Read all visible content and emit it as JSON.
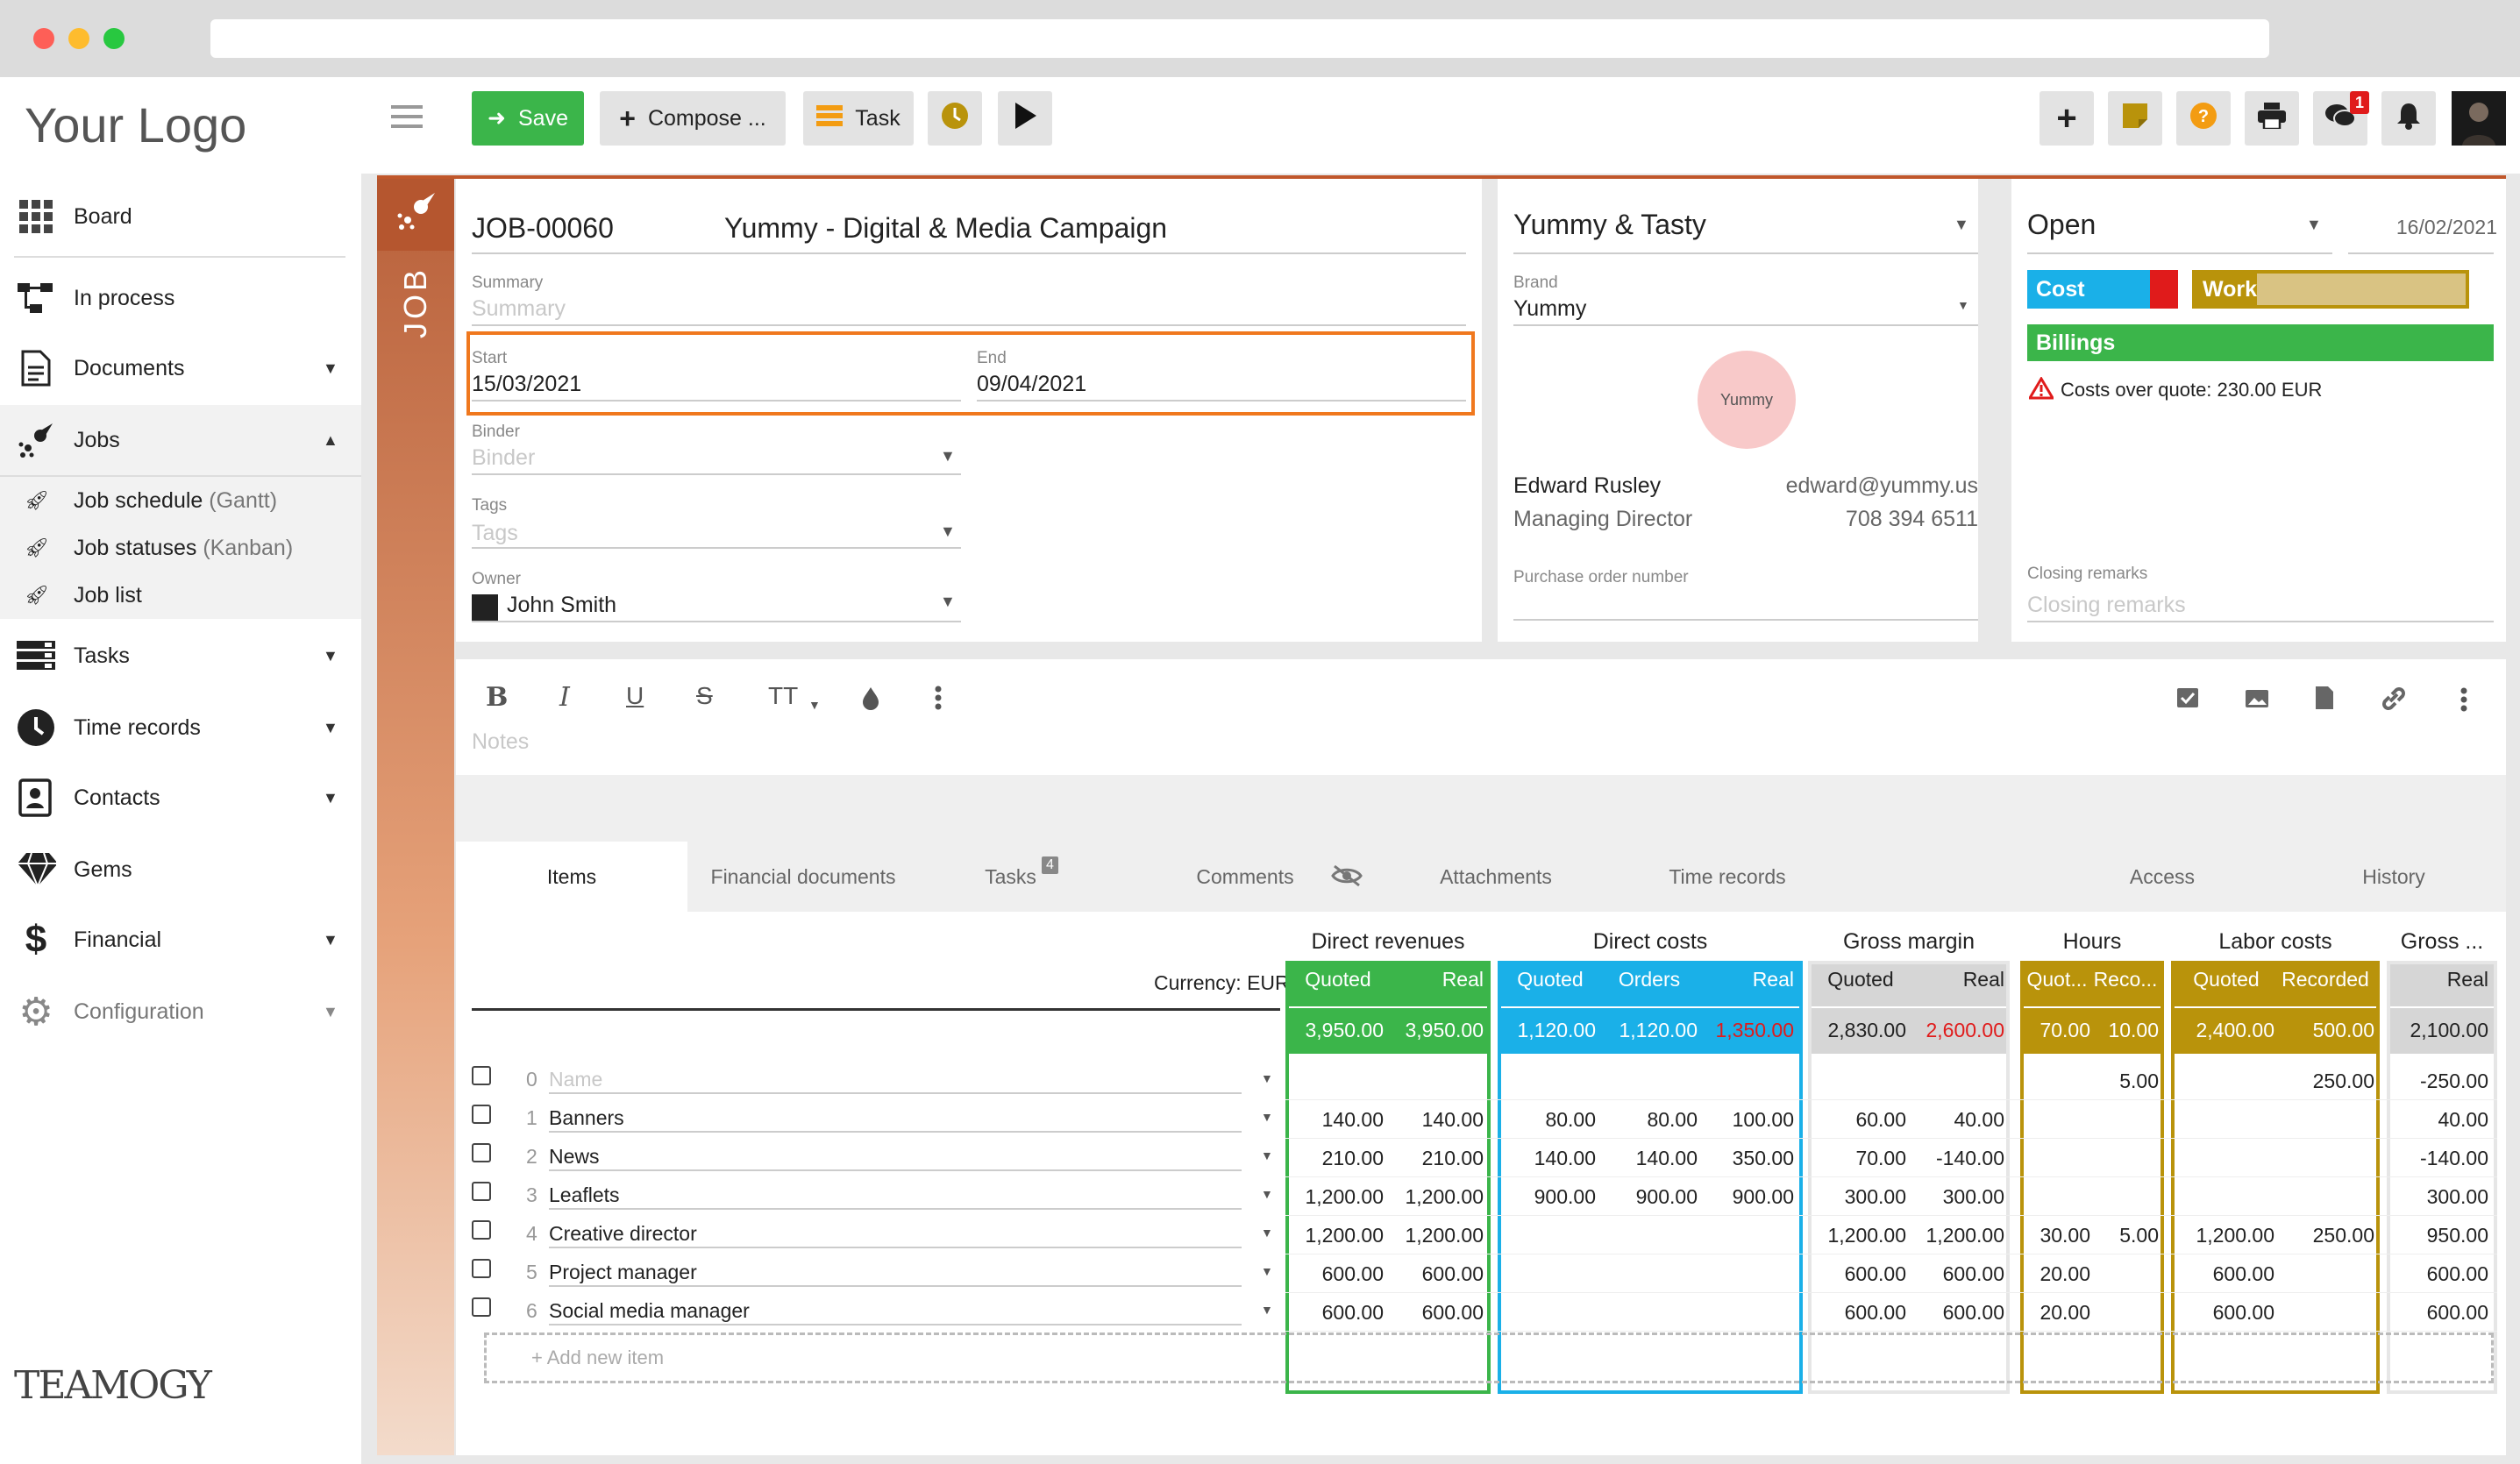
{
  "brand": {
    "logo_text": "Your Logo",
    "footer_logo": "TEAMOGY"
  },
  "sidebar": {
    "items": [
      {
        "label": "Board",
        "icon": "grid-icon"
      },
      {
        "label": "In process",
        "icon": "workflow-icon"
      },
      {
        "label": "Documents",
        "icon": "document-icon"
      },
      {
        "label": "Jobs",
        "icon": "rocket-icon"
      },
      {
        "label": "Tasks",
        "icon": "tasks-icon"
      },
      {
        "label": "Time records",
        "icon": "clock-icon"
      },
      {
        "label": "Contacts",
        "icon": "contacts-icon"
      },
      {
        "label": "Gems",
        "icon": "diamond-icon"
      },
      {
        "label": "Financial",
        "icon": "dollar-icon"
      },
      {
        "label": "Configuration",
        "icon": "gear-icon"
      }
    ],
    "jobs_sub": [
      {
        "label": "Job schedule",
        "hint": "(Gantt)"
      },
      {
        "label": "Job statuses",
        "hint": "(Kanban)"
      },
      {
        "label": "Job list",
        "hint": ""
      }
    ]
  },
  "toolbar": {
    "save": "Save",
    "compose": "Compose ...",
    "task": "Task",
    "chat_badge": "1"
  },
  "job": {
    "side_label": "JOB",
    "number": "JOB-00060",
    "title": "Yummy - Digital & Media Campaign",
    "summary_label": "Summary",
    "summary_placeholder": "Summary",
    "start_label": "Start",
    "start_value": "15/03/2021",
    "end_label": "End",
    "end_value": "09/04/2021",
    "binder_label": "Binder",
    "binder_placeholder": "Binder",
    "tags_label": "Tags",
    "tags_placeholder": "Tags",
    "owner_label": "Owner",
    "owner_value": "John Smith"
  },
  "client": {
    "name": "Yummy & Tasty",
    "brand_label": "Brand",
    "brand_value": "Yummy",
    "logo_text": "Yummy",
    "contact_name": "Edward Rusley",
    "contact_role": "Managing Director",
    "contact_email": "edward@yummy.us",
    "contact_phone": "708 394 6511",
    "po_label": "Purchase order number"
  },
  "status": {
    "value": "Open",
    "date": "16/02/2021",
    "cost_label": "Cost",
    "work_label": "Work",
    "billings_label": "Billings",
    "warning": "Costs over quote: 230.00 EUR",
    "closing_label": "Closing remarks",
    "closing_placeholder": "Closing remarks",
    "colors": {
      "cost": "#1ab0e8",
      "cost_over": "#e01b1b",
      "work": "#b9930b",
      "work_fill": "#d9c383",
      "billings": "#3bb54a"
    }
  },
  "editor": {
    "notes_placeholder": "Notes",
    "tools": [
      "B",
      "I",
      "U",
      "S",
      "TT"
    ]
  },
  "tabs": [
    {
      "label": "Items",
      "active": true
    },
    {
      "label": "Financial documents"
    },
    {
      "label": "Tasks",
      "badge": "4"
    },
    {
      "label": "Comments"
    },
    {
      "label": "Attachments"
    },
    {
      "label": "Time records"
    },
    {
      "label": "Access"
    },
    {
      "label": "History"
    }
  ],
  "grid": {
    "currency": "Currency: EUR",
    "groups": [
      {
        "title": "Direct revenues",
        "subs": [
          "Quoted",
          "Real"
        ],
        "color": "#3bb54a",
        "totals": [
          "3,950.00",
          "3,950.00"
        ]
      },
      {
        "title": "Direct costs",
        "subs": [
          "Quoted",
          "Orders",
          "Real"
        ],
        "color": "#1ab0e8",
        "totals": [
          "1,120.00",
          "1,120.00",
          "1,350.00"
        ]
      },
      {
        "title": "Gross margin",
        "subs": [
          "Quoted",
          "Real"
        ],
        "color": "#d6d6d6",
        "totals": [
          "2,830.00",
          "2,600.00"
        ]
      },
      {
        "title": "Hours",
        "subs": [
          "Quot...",
          "Reco..."
        ],
        "color": "#b9930b",
        "totals": [
          "70.00",
          "10.00"
        ]
      },
      {
        "title": "Labor costs",
        "subs": [
          "Quoted",
          "Recorded"
        ],
        "color": "#b9930b",
        "totals": [
          "2,400.00",
          "500.00"
        ]
      },
      {
        "title": "Gross ...",
        "subs": [
          "Real"
        ],
        "color": "#d6d6d6",
        "totals": [
          "2,100.00"
        ]
      }
    ],
    "rows": [
      {
        "n": "0",
        "name": "",
        "placeholder": "Name",
        "vals": [
          "",
          "",
          "",
          "",
          "",
          "",
          "",
          "",
          "5.00",
          "",
          "250.00",
          "-250.00"
        ]
      },
      {
        "n": "1",
        "name": "Banners",
        "vals": [
          "140.00",
          "140.00",
          "80.00",
          "80.00",
          "100.00",
          "60.00",
          "40.00",
          "",
          "",
          "",
          "",
          "40.00"
        ]
      },
      {
        "n": "2",
        "name": "News",
        "vals": [
          "210.00",
          "210.00",
          "140.00",
          "140.00",
          "350.00",
          "70.00",
          "-140.00",
          "",
          "",
          "",
          "",
          "-140.00"
        ]
      },
      {
        "n": "3",
        "name": "Leaflets",
        "vals": [
          "1,200.00",
          "1,200.00",
          "900.00",
          "900.00",
          "900.00",
          "300.00",
          "300.00",
          "",
          "",
          "",
          "",
          "300.00"
        ]
      },
      {
        "n": "4",
        "name": "Creative director",
        "vals": [
          "1,200.00",
          "1,200.00",
          "",
          "",
          "",
          "1,200.00",
          "1,200.00",
          "30.00",
          "5.00",
          "1,200.00",
          "250.00",
          "950.00"
        ]
      },
      {
        "n": "5",
        "name": "Project manager",
        "vals": [
          "600.00",
          "600.00",
          "",
          "",
          "",
          "600.00",
          "600.00",
          "20.00",
          "",
          "600.00",
          "",
          "600.00"
        ]
      },
      {
        "n": "6",
        "name": "Social media manager",
        "vals": [
          "600.00",
          "600.00",
          "",
          "",
          "",
          "600.00",
          "600.00",
          "20.00",
          "",
          "600.00",
          "",
          "600.00"
        ]
      }
    ],
    "add_item": "+ Add new item"
  }
}
